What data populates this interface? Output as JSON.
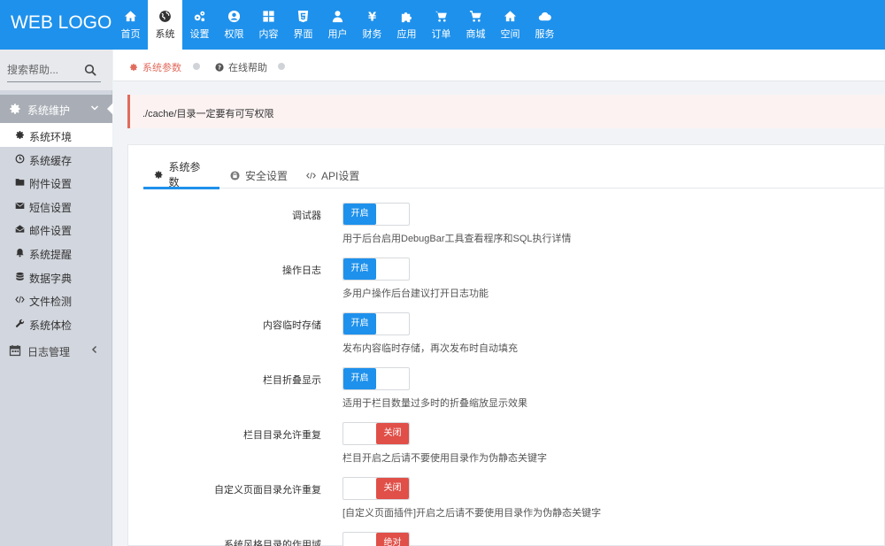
{
  "app": {
    "logo": "WEB LOGO"
  },
  "topnav": [
    {
      "label": "首页",
      "icon": "home-icon"
    },
    {
      "label": "系统",
      "icon": "globe-icon",
      "active": true
    },
    {
      "label": "设置",
      "icon": "cogs-icon"
    },
    {
      "label": "权限",
      "icon": "user-circle-icon"
    },
    {
      "label": "内容",
      "icon": "th-large-icon"
    },
    {
      "label": "界面",
      "icon": "html5-icon"
    },
    {
      "label": "用户",
      "icon": "user-icon"
    },
    {
      "label": "财务",
      "icon": "yen-icon"
    },
    {
      "label": "应用",
      "icon": "puzzle-icon"
    },
    {
      "label": "订单",
      "icon": "cart-icon"
    },
    {
      "label": "商城",
      "icon": "shopping-cart-icon"
    },
    {
      "label": "空间",
      "icon": "home-icon"
    },
    {
      "label": "服务",
      "icon": "cloud-icon"
    }
  ],
  "sidebar": {
    "search_placeholder": "搜索帮助...",
    "group_open": {
      "label": "系统维护",
      "icon": "cog-icon"
    },
    "items": [
      {
        "label": "系统环境",
        "icon": "cog-icon",
        "active": true
      },
      {
        "label": "系统缓存",
        "icon": "clock-icon"
      },
      {
        "label": "附件设置",
        "icon": "folder-icon"
      },
      {
        "label": "短信设置",
        "icon": "envelope-icon"
      },
      {
        "label": "邮件设置",
        "icon": "envelope-open-icon"
      },
      {
        "label": "系统提醒",
        "icon": "bell-icon"
      },
      {
        "label": "数据字典",
        "icon": "database-icon"
      },
      {
        "label": "文件检测",
        "icon": "code-icon"
      },
      {
        "label": "系统体检",
        "icon": "wrench-icon"
      }
    ],
    "group_closed": {
      "label": "日志管理",
      "icon": "calendar-icon"
    }
  },
  "breadcrumb": [
    {
      "label": "系统参数",
      "icon": "cog-icon"
    },
    {
      "label": "在线帮助",
      "icon": "question-circle-icon"
    }
  ],
  "alert": {
    "text": "./cache/目录一定要有可写权限"
  },
  "tabs": [
    {
      "label": "系统参数",
      "icon": "cog-icon"
    },
    {
      "label": "安全设置",
      "icon": "lock-icon"
    },
    {
      "label": "API设置",
      "icon": "code-icon"
    }
  ],
  "settings": [
    {
      "label": "调试器",
      "state": "on",
      "switch_text": "开启",
      "help": "用于后台启用DebugBar工具查看程序和SQL执行详情"
    },
    {
      "label": "操作日志",
      "state": "on",
      "switch_text": "开启",
      "help": "多用户操作后台建议打开日志功能"
    },
    {
      "label": "内容临时存储",
      "state": "on",
      "switch_text": "开启",
      "help": "发布内容临时存储，再次发布时自动填充"
    },
    {
      "label": "栏目折叠显示",
      "state": "on",
      "switch_text": "开启",
      "help": "适用于栏目数量过多时的折叠缩放显示效果"
    },
    {
      "label": "栏目目录允许重复",
      "state": "off",
      "switch_text": "关闭",
      "help": "栏目开启之后请不要使用目录作为伪静态关键字"
    },
    {
      "label": "自定义页面目录允许重复",
      "state": "off",
      "switch_text": "关闭",
      "help": "[自定义页面插件]开启之后请不要使用目录作为伪静态关键字"
    },
    {
      "label": "系统风格目录的作用域",
      "state": "off",
      "switch_text": "绝对",
      "help": ""
    }
  ],
  "colors": {
    "primary": "#1e91ec",
    "danger": "#e04f48",
    "accent_text": "#e16b5d"
  }
}
